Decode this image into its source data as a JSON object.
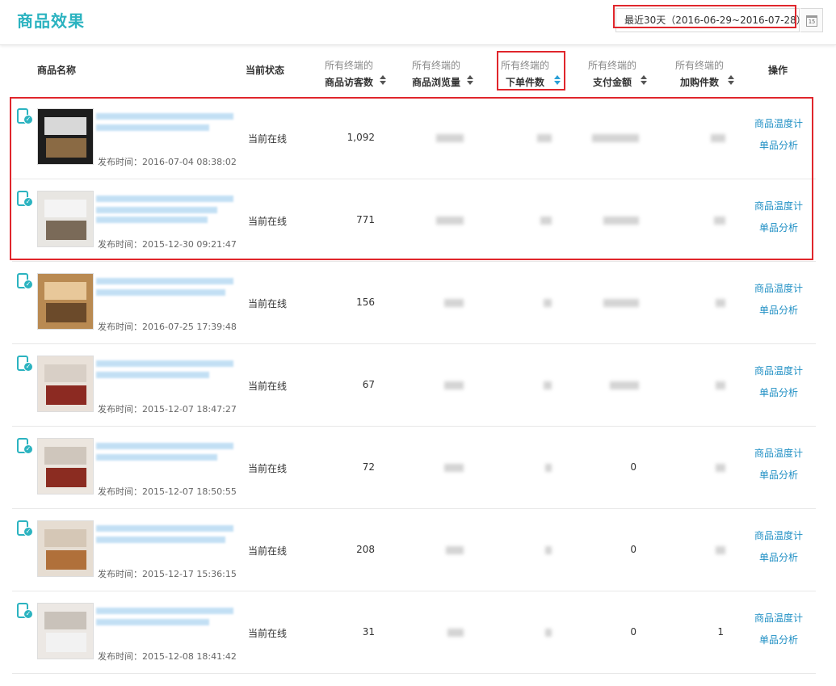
{
  "header": {
    "title": "商品效果",
    "date_range": "最近30天（2016-06-29~2016-07-28）",
    "calendar_day": "15"
  },
  "columns": {
    "name": "商品名称",
    "status": "当前状态",
    "visitors": {
      "top": "所有终端的",
      "bottom": "商品访客数"
    },
    "pageviews": {
      "top": "所有终端的",
      "bottom": "商品浏览量"
    },
    "orders": {
      "top": "所有终端的",
      "bottom": "下单件数"
    },
    "payment": {
      "top": "所有终端的",
      "bottom": "支付金额"
    },
    "cart": {
      "top": "所有终端的",
      "bottom": "加购件数"
    },
    "actions": "操作"
  },
  "rows": [
    {
      "published": "发布时间：2016-07-04 08:38:02",
      "status": "当前在线",
      "visitors": "1,092",
      "payment": "",
      "cart": "",
      "thumb_colors": [
        "#1d1d1d",
        "#8a6a44",
        "#d8d8d8"
      ]
    },
    {
      "published": "发布时间：2015-12-30 09:21:47",
      "status": "当前在线",
      "visitors": "771",
      "payment": "",
      "cart": "",
      "thumb_colors": [
        "#e8e6e2",
        "#7a6a58",
        "#f4f4f4"
      ]
    },
    {
      "published": "发布时间：2016-07-25 17:39:48",
      "status": "当前在线",
      "visitors": "156",
      "payment": "",
      "cart": "",
      "thumb_colors": [
        "#b98a52",
        "#6b4a2a",
        "#e8c89a"
      ]
    },
    {
      "published": "发布时间：2015-12-07 18:47:27",
      "status": "当前在线",
      "visitors": "67",
      "payment": "",
      "cart": "",
      "thumb_colors": [
        "#e9e1d9",
        "#8c2a22",
        "#d8cfc6"
      ]
    },
    {
      "published": "发布时间：2015-12-07 18:50:55",
      "status": "当前在线",
      "visitors": "72",
      "payment": "0",
      "cart": "",
      "thumb_colors": [
        "#ece6df",
        "#8b2c21",
        "#cfc6bc"
      ]
    },
    {
      "published": "发布时间：2015-12-17 15:36:15",
      "status": "当前在线",
      "visitors": "208",
      "payment": "0",
      "cart": "",
      "thumb_colors": [
        "#e6ddd2",
        "#b0703a",
        "#d5c7b6"
      ]
    },
    {
      "published": "发布时间：2015-12-08 18:41:42",
      "status": "当前在线",
      "visitors": "31",
      "payment": "0",
      "cart": "1",
      "thumb_colors": [
        "#ece8e4",
        "#f2f2f2",
        "#c9c2ba"
      ]
    }
  ],
  "actions": {
    "temperature": "商品温度计",
    "analysis": "单品分析"
  }
}
